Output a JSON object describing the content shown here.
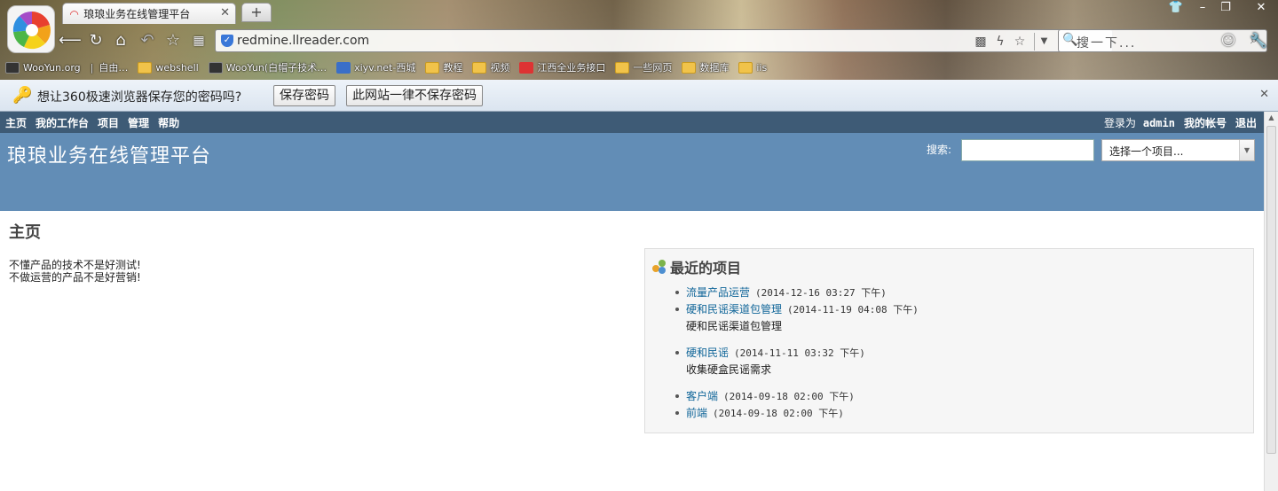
{
  "browser": {
    "tab_title": "琅琅业务在线管理平台",
    "url": "redmine.llreader.com",
    "search_placeholder": "搜一下...",
    "bookmarks": [
      {
        "label": "WooYun.org",
        "icon": "dark"
      },
      {
        "label": "自由…",
        "icon": "none"
      },
      {
        "label": "webshell",
        "icon": "folder"
      },
      {
        "label": "WooYun(白帽子技术…",
        "icon": "dark"
      },
      {
        "label": "xiyv.net-西城",
        "icon": "blue"
      },
      {
        "label": "教程",
        "icon": "folder"
      },
      {
        "label": "视频",
        "icon": "folder"
      },
      {
        "label": "江西全业务接口",
        "icon": "red"
      },
      {
        "label": "一些网页",
        "icon": "folder"
      },
      {
        "label": "数据库",
        "icon": "folder"
      },
      {
        "label": "iis",
        "icon": "folder"
      }
    ]
  },
  "password_bar": {
    "question": "想让360极速浏览器保存您的密码吗?",
    "save_label": "保存密码",
    "never_label": "此网站一律不保存密码"
  },
  "top_menu": {
    "items": [
      "主页",
      "我的工作台",
      "项目",
      "管理",
      "帮助"
    ],
    "logged_as": "登录为",
    "user": "admin",
    "account": "我的帐号",
    "logout": "退出"
  },
  "header": {
    "title": "琅琅业务在线管理平台",
    "search_label": "搜索:",
    "project_select": "选择一个项目..."
  },
  "main": {
    "heading": "主页",
    "intro_lines": [
      "不懂产品的技术不是好测试!",
      "不做运营的产品不是好营销!"
    ],
    "latest_projects_title": "最近的项目",
    "projects": [
      {
        "name": "流量产品运营",
        "time": "(2014-12-16 03:27 下午)",
        "desc": ""
      },
      {
        "name": "硬和民谣渠道包管理",
        "time": "(2014-11-19 04:08 下午)",
        "desc": "硬和民谣渠道包管理"
      },
      {
        "name": "硬和民谣",
        "time": "(2014-11-11 03:32 下午)",
        "desc": "收集硬盒民谣需求"
      },
      {
        "name": "客户端",
        "time": "(2014-09-18 02:00 下午)",
        "desc": ""
      },
      {
        "name": "前端",
        "time": "(2014-09-18 02:00 下午)",
        "desc": ""
      }
    ]
  },
  "colors": {
    "top_menu_bg": "#3e5b76",
    "header_bg": "#628db6",
    "link": "#116699"
  }
}
